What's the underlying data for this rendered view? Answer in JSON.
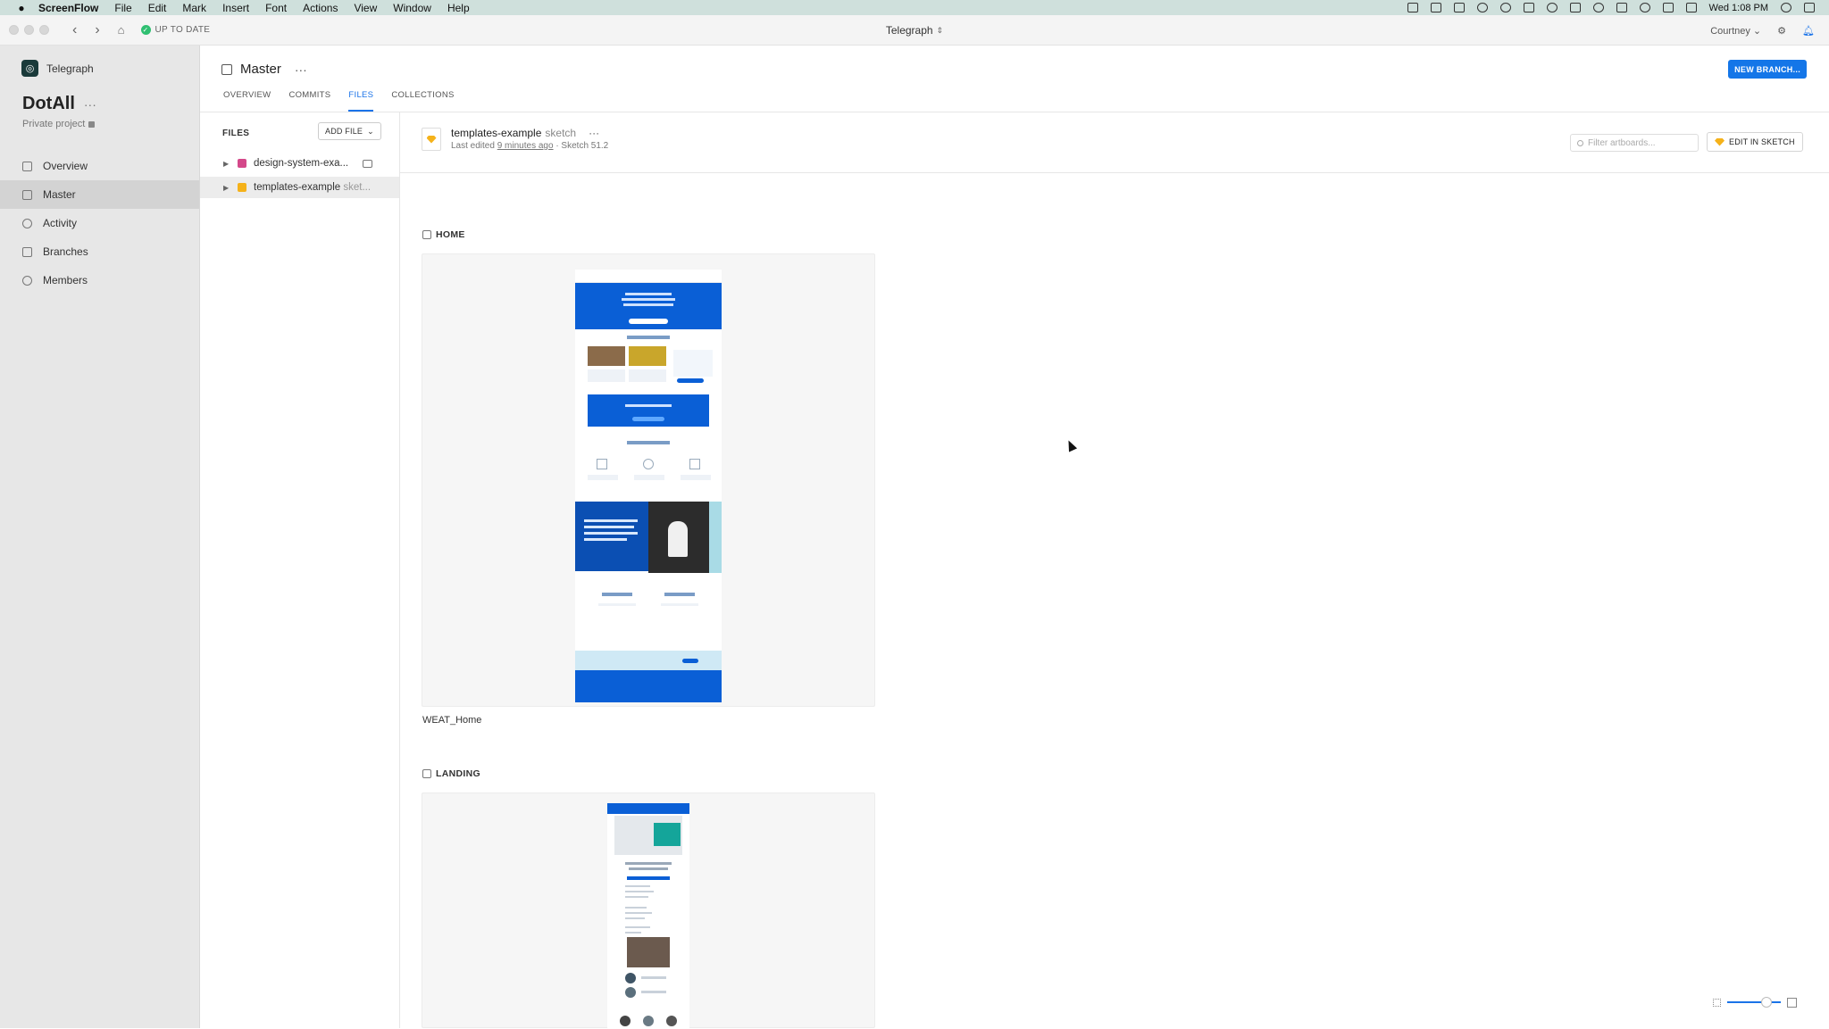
{
  "menubar": {
    "app_name": "ScreenFlow",
    "items": [
      "File",
      "Edit",
      "Mark",
      "Insert",
      "Font",
      "Actions",
      "View",
      "Window",
      "Help"
    ],
    "clock": "Wed 1:08 PM"
  },
  "titlebar": {
    "status": "UP TO DATE",
    "title": "Telegraph",
    "user": "Courtney"
  },
  "sidebar": {
    "brand": "Telegraph",
    "project_name": "DotAll",
    "project_more": "···",
    "project_sub": "Private project",
    "nav": [
      {
        "label": "Overview",
        "active": false
      },
      {
        "label": "Master",
        "active": true
      },
      {
        "label": "Activity",
        "active": false
      },
      {
        "label": "Branches",
        "active": false
      },
      {
        "label": "Members",
        "active": false
      }
    ]
  },
  "header": {
    "branch": "Master",
    "more": "···",
    "tabs": [
      {
        "label": "OVERVIEW",
        "active": false
      },
      {
        "label": "COMMITS",
        "active": false
      },
      {
        "label": "FILES",
        "active": true
      },
      {
        "label": "COLLECTIONS",
        "active": false
      }
    ],
    "new_branch": "NEW BRANCH..."
  },
  "files": {
    "heading": "FILES",
    "add_file": "ADD FILE",
    "items": [
      {
        "name": "design-system-exa...",
        "ext": "",
        "color": "#d4488a",
        "active": false
      },
      {
        "name": "templates-example",
        "ext": " sket...",
        "color": "#f5b21a",
        "active": true
      }
    ]
  },
  "document": {
    "name": "templates-example",
    "ext": " sketch",
    "more": "···",
    "edited_prefix": "Last edited ",
    "edited_link": "9 minutes ago",
    "edited_suffix": " · Sketch 51.2",
    "filter_placeholder": "Filter artboards...",
    "edit_button": "EDIT IN SKETCH"
  },
  "sections": [
    {
      "label": "HOME",
      "artboard": "WEAT_Home"
    },
    {
      "label": "LANDING",
      "artboard": ""
    }
  ],
  "colors": {
    "accent": "#1476e8",
    "brand_blue": "#0a5fd6",
    "sidebar_bg": "#e7e7e7"
  }
}
